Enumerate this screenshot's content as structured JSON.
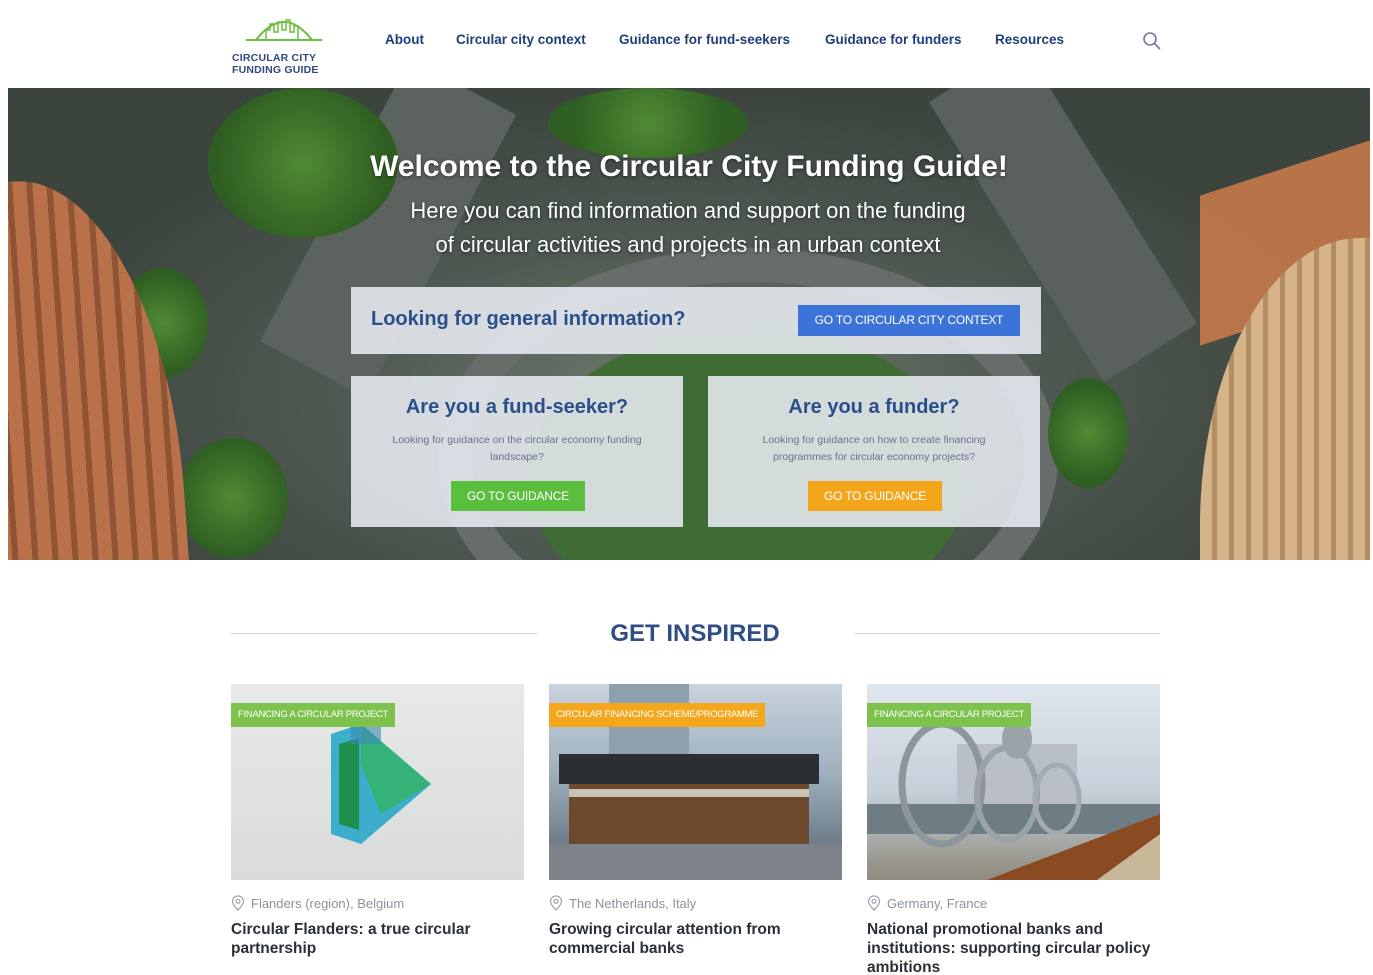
{
  "brand": {
    "line1": "CIRCULAR CITY",
    "line2": "FUNDING GUIDE"
  },
  "nav": {
    "items": [
      {
        "label": "About"
      },
      {
        "label": "Circular city context"
      },
      {
        "label": "Guidance for fund-seekers"
      },
      {
        "label": "Guidance for funders"
      },
      {
        "label": "Resources"
      }
    ]
  },
  "hero": {
    "title": "Welcome to the Circular City Funding Guide!",
    "subtitle_line1": "Here you can find information and support on the funding",
    "subtitle_line2": "of circular activities and projects in an urban context",
    "general": {
      "question": "Looking for general information?",
      "button": "GO TO CIRCULAR CITY CONTEXT"
    },
    "seeker": {
      "question": "Are you a fund-seeker?",
      "description": "Looking for guidance on the circular economy funding landscape?",
      "button": "GO TO GUIDANCE"
    },
    "funder": {
      "question": "Are you a funder?",
      "description": "Looking for guidance on how to create financing programmes for circular economy projects?",
      "button": "GO TO GUIDANCE"
    }
  },
  "inspired": {
    "heading": "GET INSPIRED",
    "cards": [
      {
        "tag": "FINANCING A CIRCULAR PROJECT",
        "location": "Flanders (region), Belgium",
        "title": "Circular Flanders: a true circular partnership"
      },
      {
        "tag": "CIRCULAR FINANCING SCHEME/PROGRAMME",
        "location": "The Netherlands, Italy",
        "title": "Growing circular attention from commercial banks"
      },
      {
        "tag": "FINANCING A CIRCULAR PROJECT",
        "location": "Germany, France",
        "title": "National promotional banks and institutions: supporting circular policy ambitions"
      }
    ]
  },
  "colors": {
    "navy": "#1f3d7a",
    "blue_button": "#3b73d9",
    "green_button": "#5bbf3e",
    "orange_button": "#f3a51c",
    "tag_green": "#7cc24d",
    "tag_orange": "#f4a71c"
  }
}
